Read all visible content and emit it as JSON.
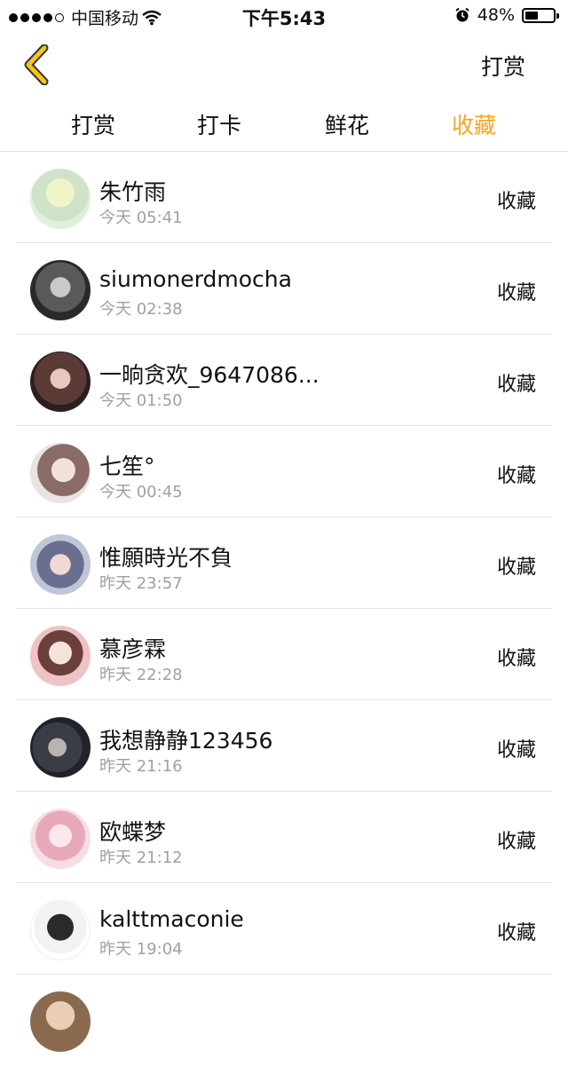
{
  "status_bar": {
    "carrier": "中国移动",
    "time": "下午5:43",
    "battery_text": "48%",
    "battery_level": 0.48
  },
  "nav": {
    "back_icon": "chevron-left-icon",
    "back_color": "#f5c518",
    "action_label": "打赏"
  },
  "tabs": [
    {
      "label": "打赏",
      "active": false
    },
    {
      "label": "打卡",
      "active": false
    },
    {
      "label": "鲜花",
      "active": false
    },
    {
      "label": "收藏",
      "active": true
    }
  ],
  "accent_color": "#f5a623",
  "list": [
    {
      "name": "朱竹雨",
      "time": "今天 05:41",
      "action": "收藏"
    },
    {
      "name": "siumonerdmocha",
      "time": "今天 02:38",
      "action": "收藏"
    },
    {
      "name": "一晌贪欢_9647086...",
      "time": "今天 01:50",
      "action": "收藏"
    },
    {
      "name": "七笙°",
      "time": "今天 00:45",
      "action": "收藏"
    },
    {
      "name": "惟願時光不負",
      "time": "昨天 23:57",
      "action": "收藏"
    },
    {
      "name": "慕彦霖",
      "time": "昨天 22:28",
      "action": "收藏"
    },
    {
      "name": "我想静静123456",
      "time": "昨天 21:16",
      "action": "收藏"
    },
    {
      "name": "欧蝶梦",
      "time": "昨天 21:12",
      "action": "收藏"
    },
    {
      "name": "kalttmaconie",
      "time": "昨天 19:04",
      "action": "收藏"
    }
  ]
}
